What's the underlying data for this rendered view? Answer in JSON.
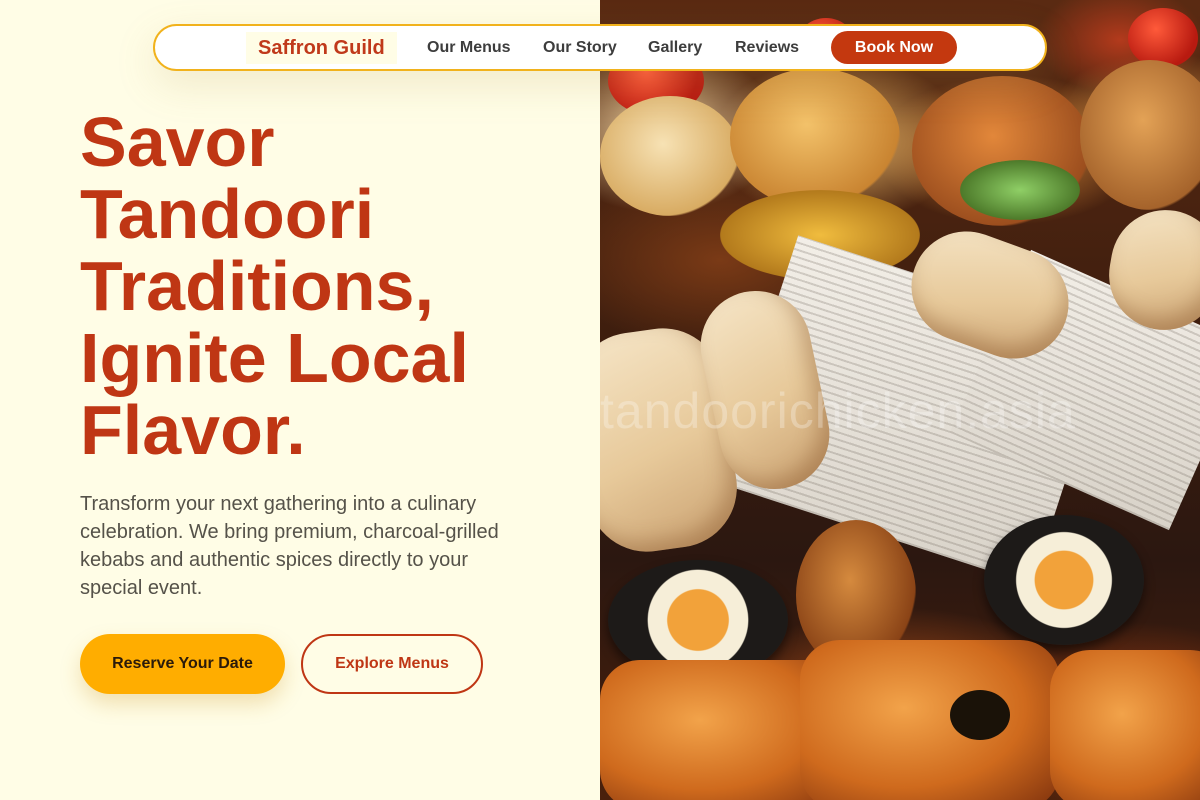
{
  "header": {
    "brand": "Saffron Guild",
    "nav": [
      {
        "label": "Our Menus"
      },
      {
        "label": "Our Story"
      },
      {
        "label": "Gallery"
      },
      {
        "label": "Reviews"
      }
    ],
    "cta_label": "Book Now"
  },
  "hero": {
    "title_lines": [
      "Savor",
      "Tandoori",
      "Traditions,",
      "Ignite Local",
      "Flavor."
    ],
    "body": "Transform your next gathering into a culinary celebration. We bring premium, charcoal-grilled kebabs and authentic spices directly to your special event.",
    "primary_cta": "Reserve Your Date",
    "secondary_cta": "Explore Menus"
  },
  "image": {
    "watermark": "tandoorichicken.asia",
    "subject": "food-platter-photo"
  },
  "colors": {
    "background": "#fffde6",
    "brand_red": "#bf3614",
    "accent_yellow": "#ffad00",
    "nav_border": "#f1b21c",
    "body_text": "#555249"
  }
}
